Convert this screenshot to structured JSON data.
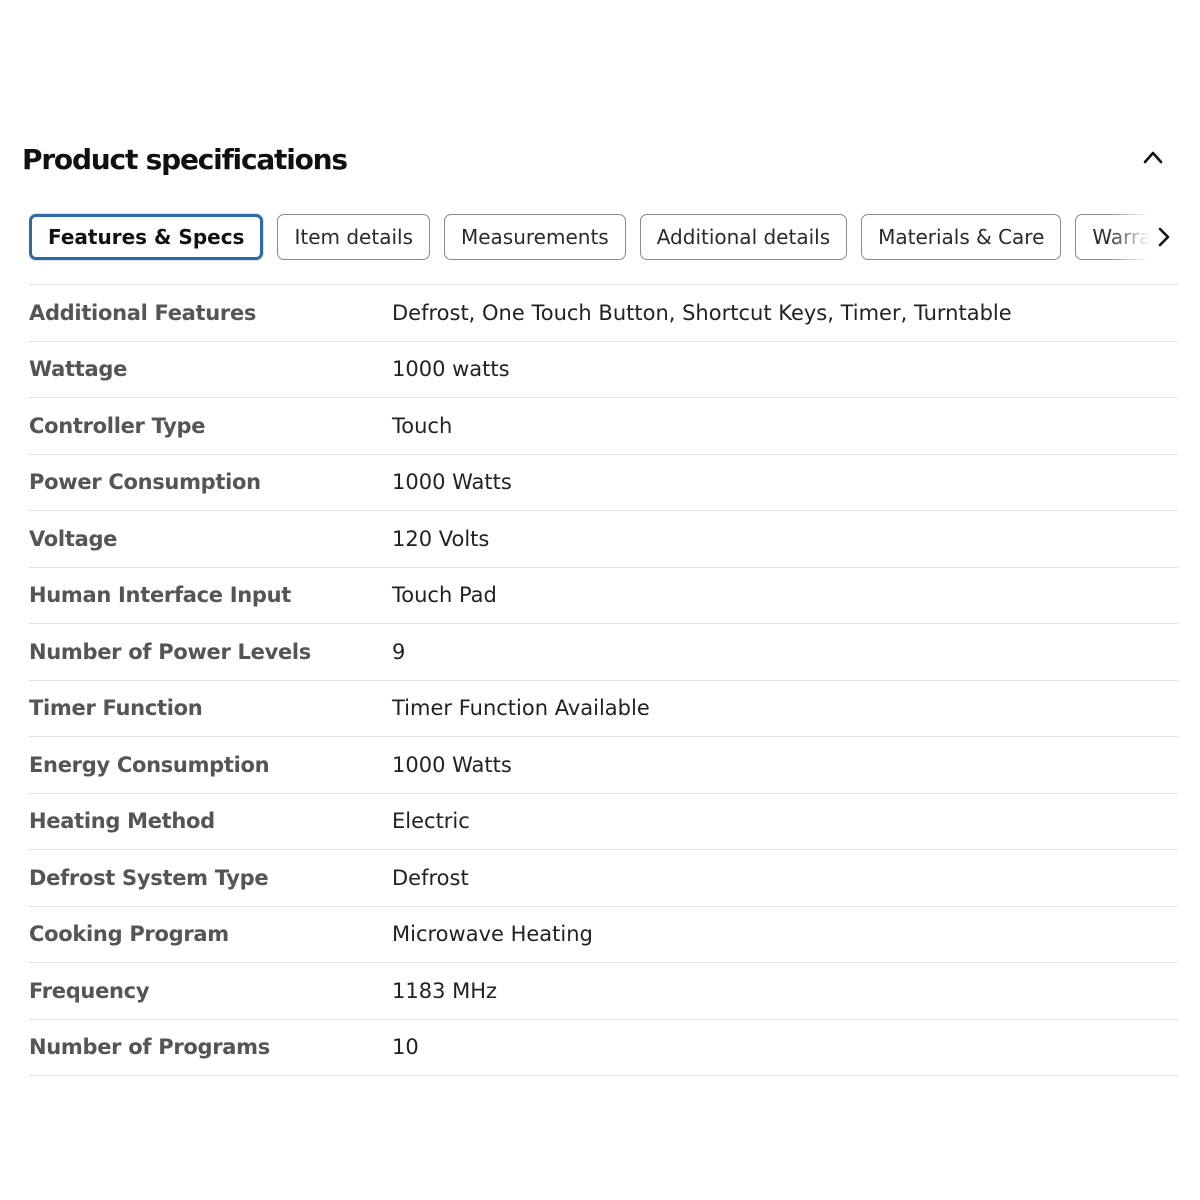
{
  "header": {
    "title": "Product specifications",
    "collapse_icon": "chevron-up-icon"
  },
  "tabs": [
    {
      "label": "Features & Specs",
      "active": true
    },
    {
      "label": "Item details",
      "active": false
    },
    {
      "label": "Measurements",
      "active": false
    },
    {
      "label": "Additional details",
      "active": false
    },
    {
      "label": "Materials & Care",
      "active": false
    },
    {
      "label": "Warranty",
      "active": false
    }
  ],
  "tabs_next_icon": "chevron-right-icon",
  "colors": {
    "active_tab_border": "#2f6aa8",
    "label_text": "#555555",
    "value_text": "#222222",
    "divider": "#e2e2e2"
  },
  "specs": [
    {
      "label": "Additional Features",
      "value": "Defrost, One Touch Button, Shortcut Keys, Timer, Turntable"
    },
    {
      "label": "Wattage",
      "value": "1000 watts"
    },
    {
      "label": "Controller Type",
      "value": "Touch"
    },
    {
      "label": "Power Consumption",
      "value": "1000 Watts"
    },
    {
      "label": "Voltage",
      "value": "120 Volts"
    },
    {
      "label": "Human Interface Input",
      "value": "Touch Pad"
    },
    {
      "label": "Number of Power Levels",
      "value": "9"
    },
    {
      "label": "Timer Function",
      "value": "Timer Function Available"
    },
    {
      "label": "Energy Consumption",
      "value": "1000 Watts"
    },
    {
      "label": "Heating Method",
      "value": "Electric"
    },
    {
      "label": "Defrost System Type",
      "value": "Defrost"
    },
    {
      "label": "Cooking Program",
      "value": "Microwave Heating"
    },
    {
      "label": "Frequency",
      "value": "1183 MHz"
    },
    {
      "label": "Number of Programs",
      "value": "10"
    }
  ]
}
